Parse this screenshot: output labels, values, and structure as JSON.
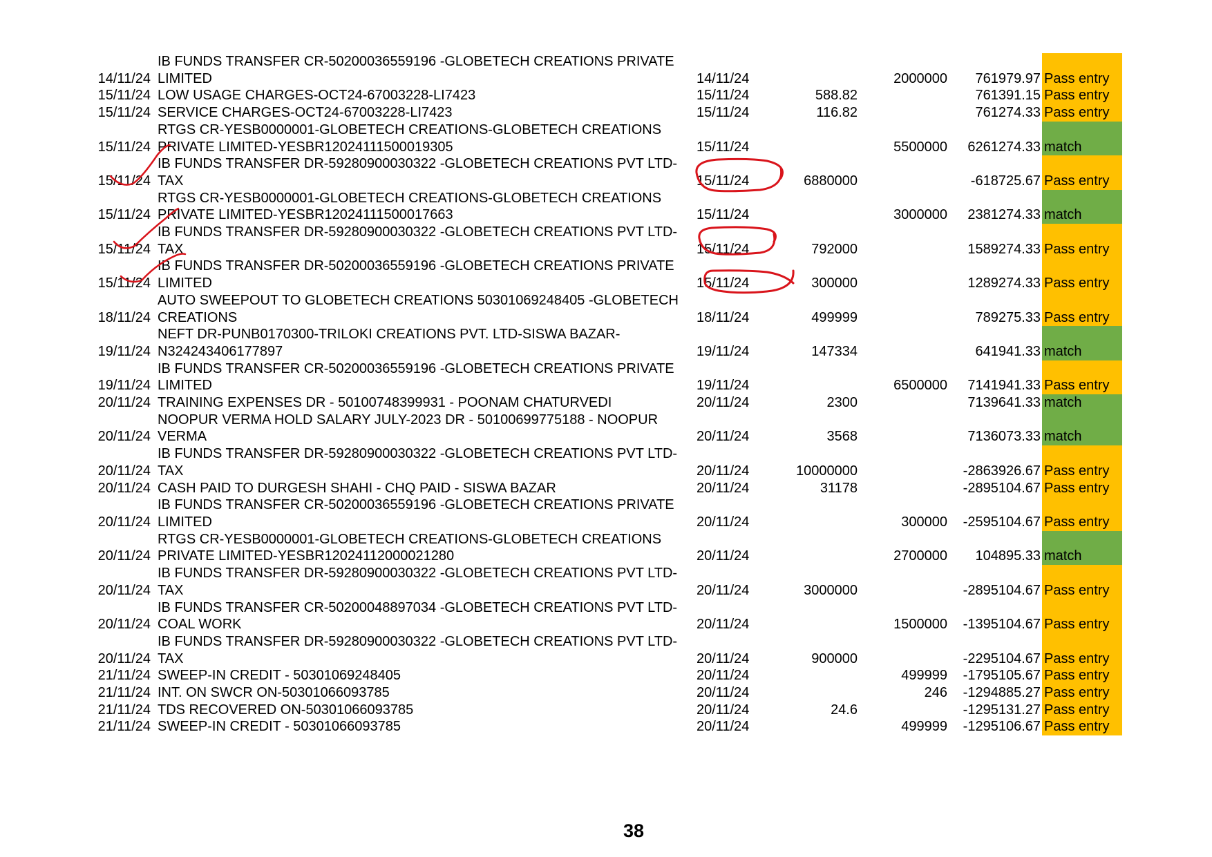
{
  "rows": [
    {
      "date": "14/11/24",
      "desc": "IB FUNDS TRANSFER CR-50200036559196 -GLOBETECH CREATIONS PRIVATE LIMITED",
      "vdate": "14/11/24",
      "dr": "",
      "cr": "2000000",
      "bal": "761979.97",
      "status": "Pass entry",
      "kind": "pass",
      "lines": 2
    },
    {
      "date": "15/11/24",
      "desc": "LOW USAGE CHARGES-OCT24-67003228-LI7423",
      "vdate": "15/11/24",
      "dr": "588.82",
      "cr": "",
      "bal": "761391.15",
      "status": "Pass entry",
      "kind": "pass",
      "lines": 1
    },
    {
      "date": "15/11/24",
      "desc": "SERVICE CHARGES-OCT24-67003228-LI7423",
      "vdate": "15/11/24",
      "dr": "116.82",
      "cr": "",
      "bal": "761274.33",
      "status": "Pass entry",
      "kind": "pass",
      "lines": 1
    },
    {
      "date": "15/11/24",
      "desc": "RTGS CR-YESB0000001-GLOBETECH CREATIONS-GLOBETECH CREATIONS PRIVATE LIMITED-YESBR12024111500019305",
      "vdate": "15/11/24",
      "dr": "",
      "cr": "5500000",
      "bal": "6261274.33",
      "status": "match",
      "kind": "match",
      "lines": 2
    },
    {
      "date": "15/11/24",
      "desc": "IB FUNDS TRANSFER DR-59280900030322 -GLOBETECH CREATIONS PVT LTD-TAX",
      "vdate": "15/11/24",
      "dr": "6880000",
      "cr": "",
      "bal": "-618725.67",
      "status": "Pass entry",
      "kind": "pass",
      "lines": 2
    },
    {
      "date": "15/11/24",
      "desc": "RTGS CR-YESB0000001-GLOBETECH CREATIONS-GLOBETECH CREATIONS PRIVATE LIMITED-YESBR12024111500017663",
      "vdate": "15/11/24",
      "dr": "",
      "cr": "3000000",
      "bal": "2381274.33",
      "status": "match",
      "kind": "match",
      "lines": 2
    },
    {
      "date": "15/11/24",
      "desc": "IB FUNDS TRANSFER DR-59280900030322 -GLOBETECH CREATIONS PVT LTD-TAX",
      "vdate": "15/11/24",
      "dr": "792000",
      "cr": "",
      "bal": "1589274.33",
      "status": "Pass entry",
      "kind": "pass",
      "lines": 2
    },
    {
      "date": "15/11/24",
      "desc": "IB FUNDS TRANSFER DR-50200036559196 -GLOBETECH CREATIONS PRIVATE LIMITED",
      "vdate": "15/11/24",
      "dr": "300000",
      "cr": "",
      "bal": "1289274.33",
      "status": "Pass entry",
      "kind": "pass",
      "lines": 2
    },
    {
      "date": "18/11/24",
      "desc": "AUTO SWEEPOUT TO GLOBETECH CREATIONS 50301069248405 -GLOBETECH CREATIONS",
      "vdate": "18/11/24",
      "dr": "499999",
      "cr": "",
      "bal": "789275.33",
      "status": "Pass entry",
      "kind": "pass",
      "lines": 2
    },
    {
      "date": "19/11/24",
      "desc": "NEFT DR-PUNB0170300-TRILOKI CREATIONS PVT. LTD-SISWA BAZAR-N324243406177897",
      "vdate": "19/11/24",
      "dr": "147334",
      "cr": "",
      "bal": "641941.33",
      "status": "match",
      "kind": "match",
      "lines": 2
    },
    {
      "date": "19/11/24",
      "desc": "IB FUNDS TRANSFER CR-50200036559196 -GLOBETECH CREATIONS PRIVATE LIMITED",
      "vdate": "19/11/24",
      "dr": "",
      "cr": "6500000",
      "bal": "7141941.33",
      "status": "Pass entry",
      "kind": "pass",
      "lines": 2
    },
    {
      "date": "20/11/24",
      "desc": "TRAINING EXPENSES DR - 50100748399931 - POONAM CHATURVEDI",
      "vdate": "20/11/24",
      "dr": "2300",
      "cr": "",
      "bal": "7139641.33",
      "status": "match",
      "kind": "match",
      "lines": 1
    },
    {
      "date": "20/11/24",
      "desc": "NOOPUR VERMA HOLD SALARY JULY-2023 DR - 50100699775188 - NOOPUR VERMA",
      "vdate": "20/11/24",
      "dr": "3568",
      "cr": "",
      "bal": "7136073.33",
      "status": "match",
      "kind": "match",
      "lines": 2
    },
    {
      "date": "20/11/24",
      "desc": "IB FUNDS TRANSFER DR-59280900030322 -GLOBETECH CREATIONS PVT LTD-TAX",
      "vdate": "20/11/24",
      "dr": "10000000",
      "cr": "",
      "bal": "-2863926.67",
      "status": "Pass entry",
      "kind": "pass",
      "lines": 2
    },
    {
      "date": "20/11/24",
      "desc": "CASH PAID TO DURGESH SHAHI - CHQ PAID - SISWA BAZAR",
      "vdate": "20/11/24",
      "dr": "31178",
      "cr": "",
      "bal": "-2895104.67",
      "status": "Pass entry",
      "kind": "pass",
      "lines": 1
    },
    {
      "date": "20/11/24",
      "desc": "IB FUNDS TRANSFER CR-50200036559196 -GLOBETECH CREATIONS PRIVATE LIMITED",
      "vdate": "20/11/24",
      "dr": "",
      "cr": "300000",
      "bal": "-2595104.67",
      "status": "Pass entry",
      "kind": "pass",
      "lines": 2
    },
    {
      "date": "20/11/24",
      "desc": "RTGS CR-YESB0000001-GLOBETECH CREATIONS-GLOBETECH CREATIONS PRIVATE LIMITED-YESBR12024112000021280",
      "vdate": "20/11/24",
      "dr": "",
      "cr": "2700000",
      "bal": "104895.33",
      "status": "match",
      "kind": "match",
      "lines": 2
    },
    {
      "date": "20/11/24",
      "desc": "IB FUNDS TRANSFER DR-59280900030322 -GLOBETECH CREATIONS PVT LTD-TAX",
      "vdate": "20/11/24",
      "dr": "3000000",
      "cr": "",
      "bal": "-2895104.67",
      "status": "Pass entry",
      "kind": "pass",
      "lines": 2
    },
    {
      "date": "20/11/24",
      "desc": "IB FUNDS TRANSFER CR-50200048897034 -GLOBETECH CREATIONS PVT LTD-COAL WORK",
      "vdate": "20/11/24",
      "dr": "",
      "cr": "1500000",
      "bal": "-1395104.67",
      "status": "Pass entry",
      "kind": "pass",
      "lines": 2
    },
    {
      "date": "20/11/24",
      "desc": "IB FUNDS TRANSFER DR-59280900030322 -GLOBETECH CREATIONS PVT LTD-TAX",
      "vdate": "20/11/24",
      "dr": "900000",
      "cr": "",
      "bal": "-2295104.67",
      "status": "Pass entry",
      "kind": "pass",
      "lines": 2
    },
    {
      "date": "21/11/24",
      "desc": "SWEEP-IN CREDIT - 50301069248405",
      "vdate": "20/11/24",
      "dr": "",
      "cr": "499999",
      "bal": "-1795105.67",
      "status": "Pass entry",
      "kind": "pass",
      "lines": 1
    },
    {
      "date": "21/11/24",
      "desc": "INT. ON SWCR ON-50301066093785",
      "vdate": "20/11/24",
      "dr": "",
      "cr": "246",
      "bal": "-1294885.27",
      "status": "Pass entry",
      "kind": "pass",
      "lines": 1
    },
    {
      "date": "21/11/24",
      "desc": "TDS RECOVERED ON-50301066093785",
      "vdate": "20/11/24",
      "dr": "24.6",
      "cr": "",
      "bal": "-1295131.27",
      "status": "Pass entry",
      "kind": "pass",
      "lines": 1
    },
    {
      "date": "21/11/24",
      "desc": "SWEEP-IN CREDIT - 50301066093785",
      "vdate": "20/11/24",
      "dr": "",
      "cr": "499999",
      "bal": "-1295106.67",
      "status": "Pass entry",
      "kind": "pass",
      "lines": 1
    }
  ],
  "colors": {
    "pass_entry": "#ffc000",
    "match": "#70ad47",
    "annotation_ink": "#d9141b"
  },
  "annotations": {
    "ticks_on_rows": [
      4,
      6,
      7
    ],
    "circled_debits_on_rows": [
      4,
      6,
      7
    ]
  },
  "page_number": "38"
}
